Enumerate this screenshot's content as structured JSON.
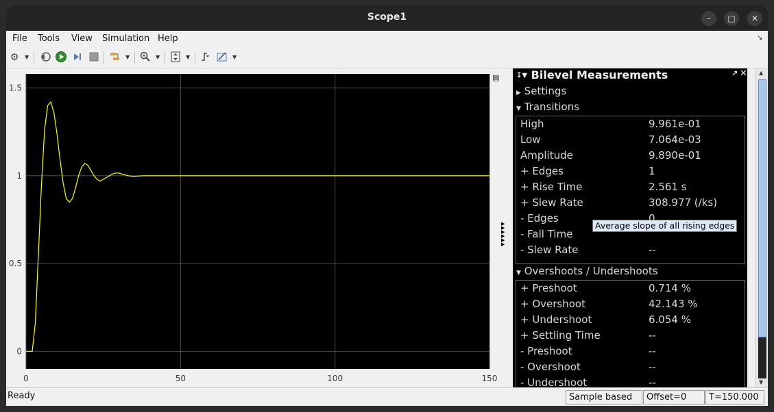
{
  "window": {
    "title": "Scope1"
  },
  "menu": [
    "File",
    "Tools",
    "View",
    "Simulation",
    "Help"
  ],
  "toolbar": {
    "icons": [
      "settings-icon",
      "step-back-icon",
      "run-icon",
      "step-forward-icon",
      "stop-icon",
      "highlight-icon",
      "zoom-icon",
      "scale-axes-icon",
      "triggers-icon",
      "measure-icon"
    ]
  },
  "colors": {
    "plot_bg": "#000000",
    "signal": "#ffff00",
    "grid": "#4d4d4d"
  },
  "chart_data": {
    "type": "line",
    "title": "",
    "xlabel": "",
    "ylabel": "",
    "xlim": [
      0,
      150
    ],
    "ylim": [
      -0.1,
      1.58
    ],
    "xticks": [
      "0",
      "50",
      "100",
      "150"
    ],
    "yticks": [
      "0",
      "0.5",
      "1",
      "1.5"
    ],
    "grid": true,
    "series": [
      {
        "x": [
          0,
          2,
          3,
          4,
          5,
          6,
          7,
          8,
          9,
          10,
          11,
          12,
          13,
          14,
          15,
          16,
          17,
          18,
          19,
          20,
          21,
          22,
          23,
          24,
          25,
          26,
          27,
          28,
          29,
          30,
          31,
          32,
          33,
          34,
          35,
          36,
          37,
          38,
          40,
          42,
          44,
          46,
          50,
          150
        ],
        "y": [
          0,
          0,
          0.16,
          0.55,
          0.95,
          1.26,
          1.4,
          1.42,
          1.36,
          1.24,
          1.09,
          0.96,
          0.87,
          0.85,
          0.87,
          0.93,
          1.0,
          1.05,
          1.07,
          1.06,
          1.03,
          1.0,
          0.98,
          0.97,
          0.98,
          0.99,
          1.0,
          1.01,
          1.015,
          1.015,
          1.01,
          1.005,
          1.0,
          0.998,
          0.997,
          0.998,
          0.999,
          1.0,
          1.0,
          1.0,
          1.0,
          1.0,
          1.0,
          1.0
        ]
      }
    ]
  },
  "measurements": {
    "title": "Bilevel Measurements",
    "settings_label": "Settings",
    "transitions_label": "Transitions",
    "transitions": [
      {
        "label": "High",
        "value": "9.961e-01"
      },
      {
        "label": "Low",
        "value": "7.064e-03"
      },
      {
        "label": "Amplitude",
        "value": "9.890e-01"
      },
      {
        "label": "+ Edges",
        "value": "1"
      },
      {
        "label": "+ Rise Time",
        "value": "2.561 s"
      },
      {
        "label": "+ Slew Rate",
        "value": "308.977 (/ks)"
      },
      {
        "label": "- Edges",
        "value": "0"
      },
      {
        "label": "- Fall Time",
        "value": ""
      },
      {
        "label": "- Slew Rate",
        "value": "--"
      }
    ],
    "tooltip": "Average slope of all rising edges",
    "overshoots_label": "Overshoots / Undershoots",
    "overshoots": [
      {
        "label": "+ Preshoot",
        "value": "0.714 %"
      },
      {
        "label": "+ Overshoot",
        "value": "42.143 %"
      },
      {
        "label": "+ Undershoot",
        "value": "6.054 %"
      },
      {
        "label": "+ Settling Time",
        "value": "--"
      },
      {
        "label": "- Preshoot",
        "value": "--"
      },
      {
        "label": "- Overshoot",
        "value": "--"
      },
      {
        "label": "- Undershoot",
        "value": "--"
      }
    ]
  },
  "status": {
    "state": "Ready",
    "mode": "Sample based",
    "offset": "Offset=0",
    "time": "T=150.000"
  }
}
